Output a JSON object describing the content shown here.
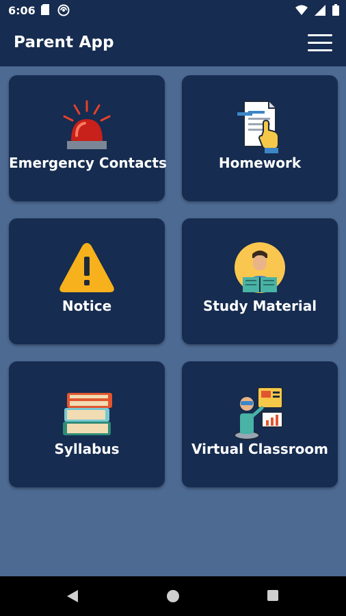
{
  "status_bar": {
    "time": "6:06",
    "icons": [
      "sd-card-icon",
      "vpn-icon",
      "wifi-icon",
      "cellular-icon",
      "battery-icon"
    ]
  },
  "app_bar": {
    "title": "Parent App",
    "menu_icon": "hamburger-menu-icon"
  },
  "tiles": [
    {
      "label": "Emergency Contacts",
      "icon": "siren-icon"
    },
    {
      "label": "Homework",
      "icon": "homework-document-icon"
    },
    {
      "label": "Notice",
      "icon": "warning-icon"
    },
    {
      "label": "Study Material",
      "icon": "student-reading-icon"
    },
    {
      "label": "Syllabus",
      "icon": "book-stack-icon"
    },
    {
      "label": "Virtual Classroom",
      "icon": "virtual-classroom-icon"
    }
  ],
  "nav_bar": {
    "buttons": [
      "back-icon",
      "home-icon",
      "recents-icon"
    ]
  },
  "colors": {
    "background": "#4d6a93",
    "header": "#162c50",
    "tile": "#162c50",
    "text": "#ffffff"
  }
}
